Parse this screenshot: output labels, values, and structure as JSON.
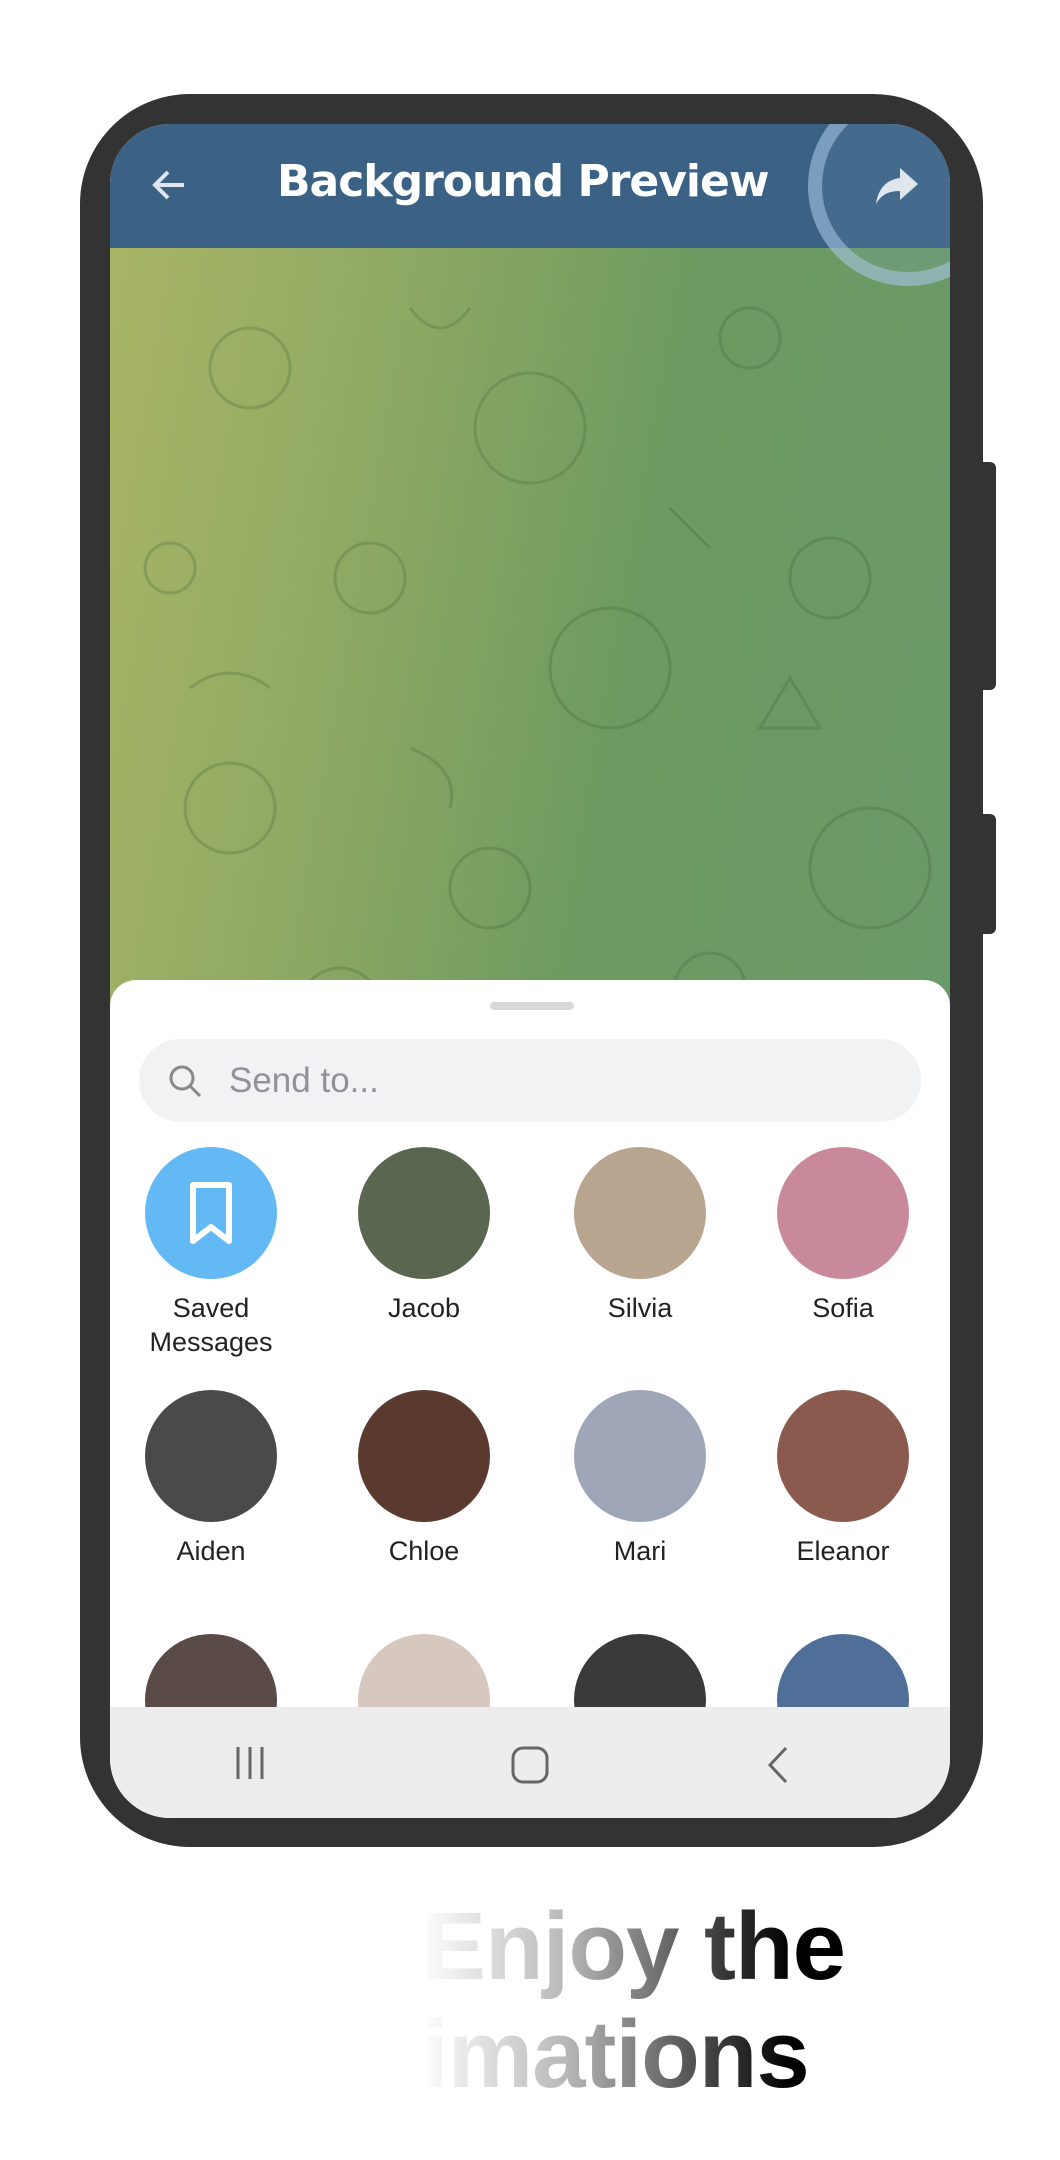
{
  "header": {
    "title": "Background Preview",
    "back_icon": "arrow-left-icon",
    "action_icon": "share-forward-icon",
    "header_color": "#3b6284"
  },
  "search": {
    "placeholder": "Send to..."
  },
  "contacts": [
    {
      "name": "Saved\nMessages",
      "icon": "bookmark-icon",
      "color": "#62b9f4"
    },
    {
      "name": "Jacob",
      "color": "#5b6650"
    },
    {
      "name": "Silvia",
      "color": "#b8a590"
    },
    {
      "name": "Sofia",
      "color": "#c88a9a"
    },
    {
      "name": "Aiden",
      "color": "#4a4a4a"
    },
    {
      "name": "Chloe",
      "color": "#5a3a2e"
    },
    {
      "name": "Mari",
      "color": "#9ea6b8"
    },
    {
      "name": "Eleanor",
      "color": "#8a5a4e"
    }
  ],
  "partial_row_colors": [
    "#5a4a48",
    "#d6c8be",
    "#3a3a3a",
    "#4f6f99"
  ],
  "navbar": {
    "recents_icon": "recents-icon",
    "home_icon": "home-icon",
    "back_icon": "nav-back-icon"
  },
  "caption": {
    "line1": "Enjoy the",
    "line2": "animations"
  }
}
